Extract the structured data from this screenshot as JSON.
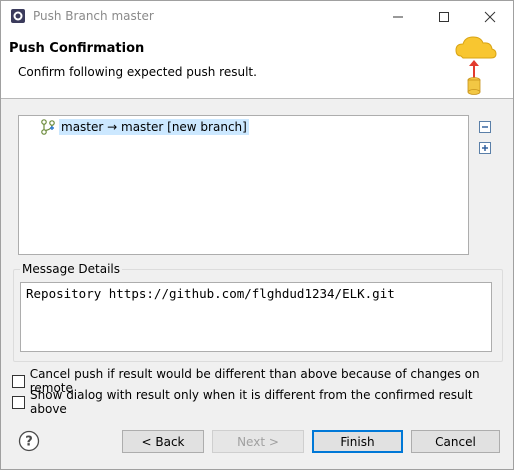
{
  "window": {
    "title": "Push Branch master",
    "minimize_icon": "minimize-icon",
    "maximize_icon": "maximize-icon",
    "close_icon": "close-icon"
  },
  "header": {
    "title": "Push Confirmation",
    "description": "Confirm following expected push result."
  },
  "result_tree": {
    "items": [
      {
        "label": "master → master [new branch]",
        "icon": "branch-icon"
      }
    ],
    "collapse_all_icon": "collapse-all-icon",
    "expand_all_icon": "expand-all-icon"
  },
  "message_details": {
    "legend": "Message Details",
    "text": "Repository https://github.com/flghdud1234/ELK.git"
  },
  "options": {
    "cancel_if_different": "Cancel push if result would be different than above because of changes on remote",
    "show_dialog_only_if_different": "Show dialog with result only when it is different from the confirmed result above"
  },
  "buttons": {
    "back": "< Back",
    "next": "Next >",
    "finish": "Finish",
    "cancel": "Cancel"
  },
  "colors": {
    "accent": "#0078d7",
    "selection": "#cce8ff"
  }
}
